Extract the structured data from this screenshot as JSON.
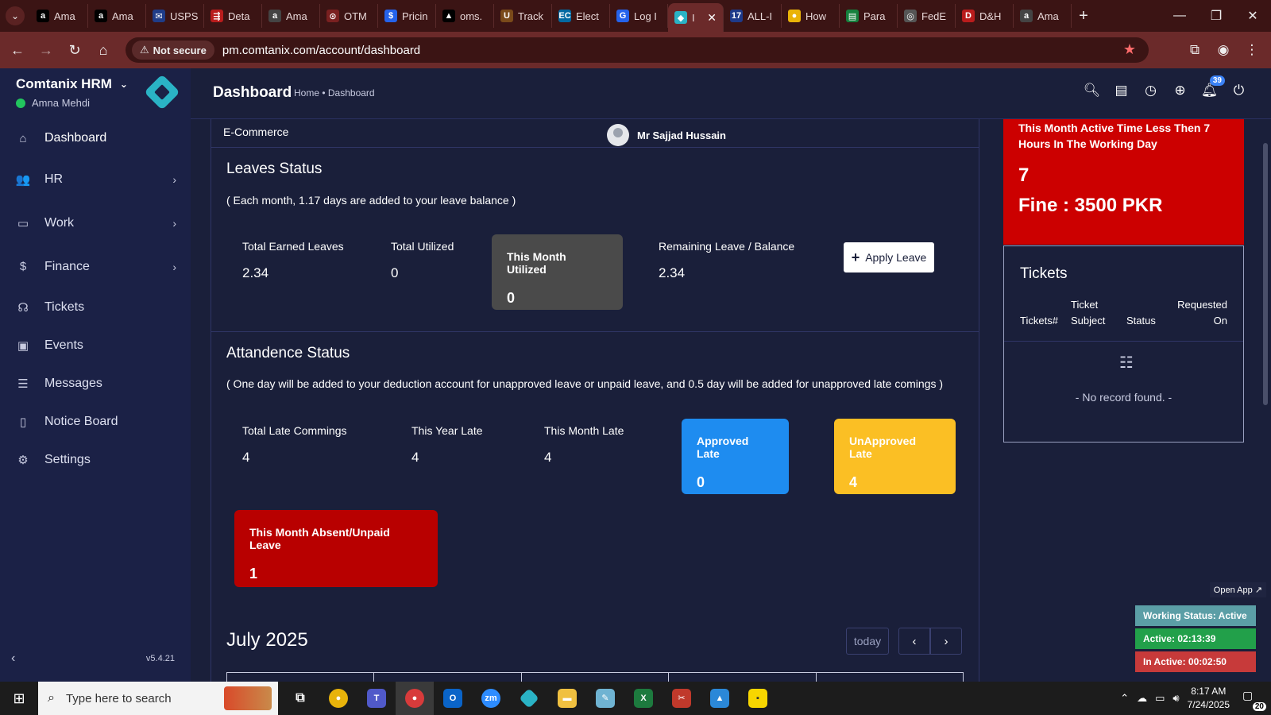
{
  "browser": {
    "tabs": [
      {
        "title": "Ama",
        "fav": "a",
        "color": "#000000"
      },
      {
        "title": "Ama",
        "fav": "a",
        "color": "#000000"
      },
      {
        "title": "USPS",
        "fav": "✉",
        "color": "#1f3c88"
      },
      {
        "title": "Deta",
        "fav": "⇶",
        "color": "#b91c1c"
      },
      {
        "title": "Ama",
        "fav": "a",
        "color": "#444444"
      },
      {
        "title": "OTM",
        "fav": "⊙",
        "color": "#7a2020"
      },
      {
        "title": "Pricin",
        "fav": "$",
        "color": "#2563eb"
      },
      {
        "title": "oms.",
        "fav": "▲",
        "color": "#000000"
      },
      {
        "title": "Track",
        "fav": "U",
        "color": "#7a4a1a"
      },
      {
        "title": "Elect",
        "fav": "EC",
        "color": "#0369a1"
      },
      {
        "title": "Log I",
        "fav": "G",
        "color": "#2563eb"
      },
      {
        "title": "I",
        "fav": "◆",
        "color": "#2ab3c5"
      },
      {
        "title": "ALL-I",
        "fav": "17",
        "color": "#1e3a8a"
      },
      {
        "title": "How",
        "fav": "●",
        "color": "#eab308"
      },
      {
        "title": "Para",
        "fav": "▤",
        "color": "#15803d"
      },
      {
        "title": "FedE",
        "fav": "◎",
        "color": "#555555"
      },
      {
        "title": "D&H",
        "fav": "D",
        "color": "#b91c1c"
      },
      {
        "title": "Ama",
        "fav": "a",
        "color": "#444444"
      }
    ],
    "security_label": "Not secure",
    "url": "pm.comtanix.com/account/dashboard"
  },
  "sidebar": {
    "brand": "Comtanix HRM",
    "user": "Amna Mehdi",
    "items": [
      {
        "label": "Dashboard",
        "icon": "home-icon",
        "glyph": "⌂",
        "arrow": false
      },
      {
        "label": "HR",
        "icon": "users-icon",
        "glyph": "👥",
        "arrow": true
      },
      {
        "label": "Work",
        "icon": "briefcase-icon",
        "glyph": "▭",
        "arrow": true
      },
      {
        "label": "Finance",
        "icon": "dollar-icon",
        "glyph": "$",
        "arrow": true
      },
      {
        "label": "Tickets",
        "icon": "headset-icon",
        "glyph": "☊",
        "arrow": false
      },
      {
        "label": "Events",
        "icon": "calendar-icon",
        "glyph": "▣",
        "arrow": false
      },
      {
        "label": "Messages",
        "icon": "message-icon",
        "glyph": "☰",
        "arrow": false
      },
      {
        "label": "Notice Board",
        "icon": "clipboard-icon",
        "glyph": "▯",
        "arrow": false
      },
      {
        "label": "Settings",
        "icon": "gear-icon",
        "glyph": "⚙",
        "arrow": false
      }
    ],
    "version": "v5.4.21"
  },
  "header": {
    "title": "Dashboard",
    "breadcrumb": "Home • Dashboard",
    "notification_count": "39"
  },
  "main": {
    "department": "E-Commerce",
    "manager": "Mr Sajjad Hussain",
    "leaves": {
      "title": "Leaves Status",
      "note": "( Each month, 1.17 days are added to your leave balance )",
      "total_earned_label": "Total Earned Leaves",
      "total_earned_value": "2.34",
      "total_utilized_label": "Total Utilized",
      "total_utilized_value": "0",
      "month_utilized_label": "This Month Utilized",
      "month_utilized_value": "0",
      "remaining_label": "Remaining Leave / Balance",
      "remaining_value": "2.34",
      "apply_button": "Apply Leave"
    },
    "attendance": {
      "title": "Attandence Status",
      "note": "( One day will be added to your deduction account for unapproved leave or unpaid leave, and 0.5 day will be added for unapproved late comings )",
      "late_label": "Total Late Commings",
      "late_value": "4",
      "year_late_label": "This Year Late",
      "year_late_value": "4",
      "month_late_label": "This Month Late",
      "month_late_value": "4",
      "approved_label": "Approved Late",
      "approved_value": "0",
      "unapproved_label": "UnApproved Late",
      "unapproved_value": "4",
      "absent_label": "This Month Absent/Unpaid Leave",
      "absent_value": "1"
    },
    "calendar": {
      "month": "July 2025",
      "today_button": "today"
    }
  },
  "right_panel": {
    "fine_message": "This Month Active Time Less Then 7 Hours In The Working Day",
    "fine_count": "7",
    "fine_amount": "Fine : 3500 PKR",
    "tickets_title": "Tickets",
    "columns": [
      "Tickets#",
      "Ticket Subject",
      "Status",
      "Requested On"
    ],
    "empty_text": "- No record found. -"
  },
  "widget": {
    "open_app": "Open App ↗",
    "working_status": "Working Status: Active",
    "active": "Active: 02:13:39",
    "inactive": "In Active: 00:02:50"
  },
  "taskbar": {
    "search_placeholder": "Type here to search",
    "time": "8:17 AM",
    "date": "7/24/2025",
    "notifications": "20"
  },
  "colors": {
    "background": "#1a1f3a",
    "sidebar": "#1b2146",
    "month_utilized_card": "#4a4a4a",
    "approved_card": "#1e8cf0",
    "unapproved_card": "#fbbf24",
    "absent_card": "#b80000",
    "fine_card": "#cc0000"
  }
}
